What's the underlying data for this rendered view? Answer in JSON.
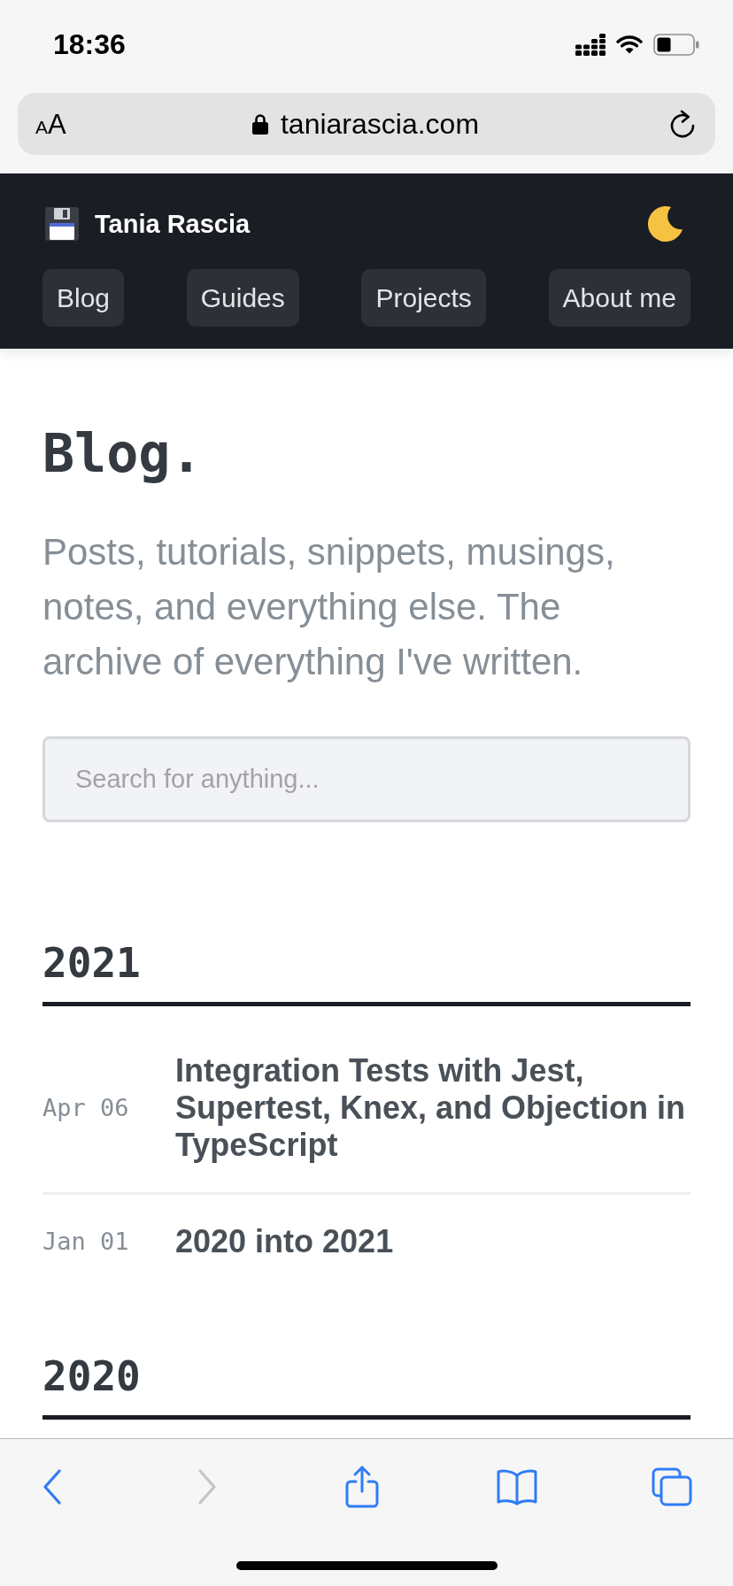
{
  "status_bar": {
    "time": "18:36"
  },
  "address_bar": {
    "text_size_label": "AA",
    "url": "taniarascia.com"
  },
  "site_header": {
    "title": "Tania Rascia",
    "nav": [
      {
        "label": "Blog"
      },
      {
        "label": "Guides"
      },
      {
        "label": "Projects"
      },
      {
        "label": "About me"
      }
    ]
  },
  "page": {
    "title": "Blog.",
    "description": "Posts, tutorials, snippets, musings, notes, and everything else. The archive of everything I've written.",
    "search": {
      "placeholder": "Search for anything..."
    }
  },
  "archive": [
    {
      "year": "2021",
      "posts": [
        {
          "date": "Apr 06",
          "title": "Integration Tests with Jest, Supertest, Knex, and Objection in TypeScript"
        },
        {
          "date": "Jan 01",
          "title": "2020 into 2021"
        }
      ]
    },
    {
      "year": "2020"
    }
  ],
  "browser_toolbar": [
    {
      "kind": "back",
      "disabled": false
    },
    {
      "kind": "forward",
      "disabled": true
    },
    {
      "kind": "share",
      "disabled": false
    },
    {
      "kind": "bookmarks",
      "disabled": false
    },
    {
      "kind": "tabs",
      "disabled": false
    }
  ]
}
